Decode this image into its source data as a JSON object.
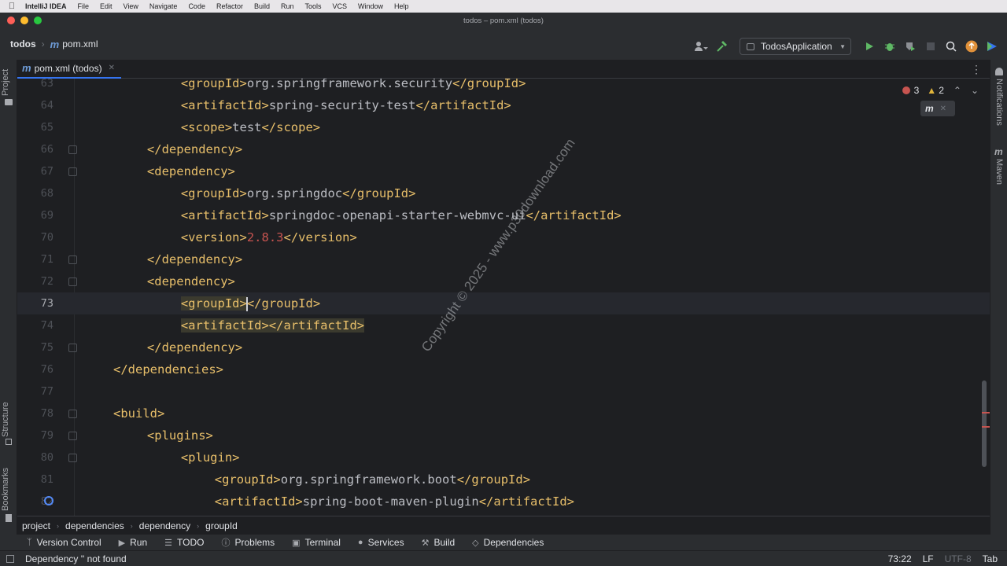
{
  "menubar": {
    "items": [
      "IntelliJ IDEA",
      "File",
      "Edit",
      "View",
      "Navigate",
      "Code",
      "Refactor",
      "Build",
      "Run",
      "Tools",
      "VCS",
      "Window",
      "Help"
    ]
  },
  "window": {
    "title": "todos – pom.xml (todos)"
  },
  "toolbar": {
    "project": "todos",
    "file": "pom.xml",
    "run_config": "TodosApplication"
  },
  "tab": {
    "label": "pom.xml (todos)"
  },
  "left_stripe": {
    "project": "Project",
    "structure": "Structure",
    "bookmarks": "Bookmarks"
  },
  "right_stripe": {
    "notifications": "Notifications",
    "maven": "Maven"
  },
  "inspections": {
    "errors": "3",
    "warnings": "2"
  },
  "editor": {
    "current_line": 73,
    "lines": [
      {
        "n": "63",
        "indent": 8,
        "parts": [
          [
            "tag",
            "<groupId>"
          ],
          [
            "txt",
            "org.springframework.security"
          ],
          [
            "tag",
            "</groupId>"
          ]
        ]
      },
      {
        "n": "64",
        "indent": 8,
        "parts": [
          [
            "tag",
            "<artifactId>"
          ],
          [
            "txt",
            "spring-security-test"
          ],
          [
            "tag",
            "</artifactId>"
          ]
        ]
      },
      {
        "n": "65",
        "indent": 8,
        "parts": [
          [
            "tag",
            "<scope>"
          ],
          [
            "txt",
            "test"
          ],
          [
            "tag",
            "</scope>"
          ]
        ]
      },
      {
        "n": "66",
        "indent": 4,
        "fold": true,
        "parts": [
          [
            "tag",
            "</dependency>"
          ]
        ]
      },
      {
        "n": "67",
        "indent": 4,
        "fold": true,
        "parts": [
          [
            "tag",
            "<dependency>"
          ]
        ]
      },
      {
        "n": "68",
        "indent": 8,
        "parts": [
          [
            "tag",
            "<groupId>"
          ],
          [
            "txt",
            "org.springdoc"
          ],
          [
            "tag",
            "</groupId>"
          ]
        ]
      },
      {
        "n": "69",
        "indent": 8,
        "parts": [
          [
            "tag",
            "<artifactId>"
          ],
          [
            "txt",
            "springdoc-openapi-starter-webmvc-ui"
          ],
          [
            "tag",
            "</artifactId>"
          ]
        ]
      },
      {
        "n": "70",
        "indent": 8,
        "parts": [
          [
            "tag",
            "<version>"
          ],
          [
            "ver",
            "2.8.3"
          ],
          [
            "tag",
            "</version>"
          ]
        ]
      },
      {
        "n": "71",
        "indent": 4,
        "fold": true,
        "parts": [
          [
            "tag",
            "</dependency>"
          ]
        ]
      },
      {
        "n": "72",
        "indent": 4,
        "fold": true,
        "parts": [
          [
            "tag",
            "<dependency>"
          ]
        ]
      },
      {
        "n": "73",
        "indent": 8,
        "current": true,
        "parts": [
          [
            "hl",
            "<groupId>"
          ],
          [
            "caret",
            ""
          ],
          [
            "tag",
            "</groupId>"
          ]
        ]
      },
      {
        "n": "74",
        "indent": 8,
        "parts": [
          [
            "hl",
            "<artifactId></artifactId>"
          ]
        ]
      },
      {
        "n": "75",
        "indent": 4,
        "fold": true,
        "parts": [
          [
            "tag",
            "</dependency>"
          ]
        ]
      },
      {
        "n": "76",
        "indent": 0,
        "parts": [
          [
            "tag",
            "</dependencies>"
          ]
        ]
      },
      {
        "n": "77",
        "indent": 0,
        "parts": []
      },
      {
        "n": "78",
        "indent": 0,
        "fold": true,
        "parts": [
          [
            "tag",
            "<build>"
          ]
        ]
      },
      {
        "n": "79",
        "indent": 4,
        "fold": true,
        "parts": [
          [
            "tag",
            "<plugins>"
          ]
        ]
      },
      {
        "n": "80",
        "indent": 8,
        "fold": true,
        "parts": [
          [
            "tag",
            "<plugin>"
          ]
        ]
      },
      {
        "n": "81",
        "indent": 12,
        "parts": [
          [
            "tag",
            "<groupId>"
          ],
          [
            "txt",
            "org.springframework.boot"
          ],
          [
            "tag",
            "</groupId>"
          ]
        ]
      },
      {
        "n": "82",
        "indent": 12,
        "run": true,
        "parts": [
          [
            "tag",
            "<artifactId>"
          ],
          [
            "txt",
            "spring-boot-maven-plugin"
          ],
          [
            "tag",
            "</artifactId>"
          ]
        ]
      }
    ]
  },
  "watermark": "Copyright © 2025 - www.p30download.com",
  "breadcrumb": [
    "project",
    "dependencies",
    "dependency",
    "groupId"
  ],
  "tool_windows": [
    {
      "icon": "version-control-icon",
      "label": "Version Control"
    },
    {
      "icon": "run-icon",
      "label": "Run"
    },
    {
      "icon": "todo-icon",
      "label": "TODO"
    },
    {
      "icon": "problems-icon",
      "label": "Problems"
    },
    {
      "icon": "terminal-icon",
      "label": "Terminal"
    },
    {
      "icon": "services-icon",
      "label": "Services"
    },
    {
      "icon": "build-icon",
      "label": "Build"
    },
    {
      "icon": "dependencies-icon",
      "label": "Dependencies"
    }
  ],
  "status": {
    "message": "Dependency '' not found",
    "position": "73:22",
    "line_sep": "LF",
    "encoding": "UTF-8",
    "indent": "Tab"
  },
  "colors": {
    "accent": "#3574f0",
    "tag": "#e8bf6a",
    "text": "#bcbec4",
    "error": "#c75450",
    "run": "#5fb865"
  }
}
